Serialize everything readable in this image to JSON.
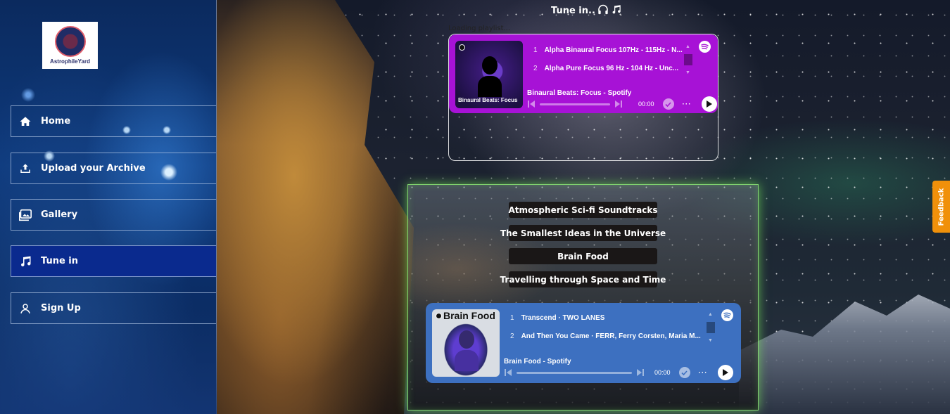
{
  "sidebar": {
    "logo_text": "AstrophileYard",
    "items": [
      {
        "label": "Home",
        "icon": "home-icon",
        "active": false
      },
      {
        "label": "Upload your Archive",
        "icon": "upload-icon",
        "active": false
      },
      {
        "label": "Gallery",
        "icon": "gallery-icon",
        "active": false
      },
      {
        "label": "Tune in",
        "icon": "music-note-icon",
        "active": true
      },
      {
        "label": "Sign Up",
        "icon": "user-icon",
        "active": false
      }
    ]
  },
  "main": {
    "title": "Tune in..",
    "title_icons": [
      "headphones-icon",
      "music-notes-icon"
    ],
    "loading_text": "Loading playlist..."
  },
  "player_top": {
    "cover_title": "Binaural Beats: Focus",
    "tracks": [
      {
        "num": "1",
        "title": "Alpha Binaural Focus 107Hz - 115Hz - N..."
      },
      {
        "num": "2",
        "title": "Alpha Pure Focus 96 Hz - 104 Hz - Unc..."
      }
    ],
    "subtitle": "Binaural Beats: Focus - Spotify",
    "time": "00:00",
    "color": "#a712d6"
  },
  "playlists": [
    {
      "label": "Atmospheric Sci-fi Soundtracks"
    },
    {
      "label": "The Smallest Ideas in the Universe"
    },
    {
      "label": "Brain Food"
    },
    {
      "label": "Travelling through Space and Time"
    }
  ],
  "player_bottom": {
    "cover_title": "Brain Food",
    "tracks": [
      {
        "num": "1",
        "title": "Transcend · TWO LANES"
      },
      {
        "num": "2",
        "title": "And Then You Came · FERR, Ferry Corsten, Maria M..."
      }
    ],
    "subtitle": "Brain Food - Spotify",
    "time": "00:00",
    "color": "#3d70c0"
  },
  "feedback_label": "Feedback"
}
